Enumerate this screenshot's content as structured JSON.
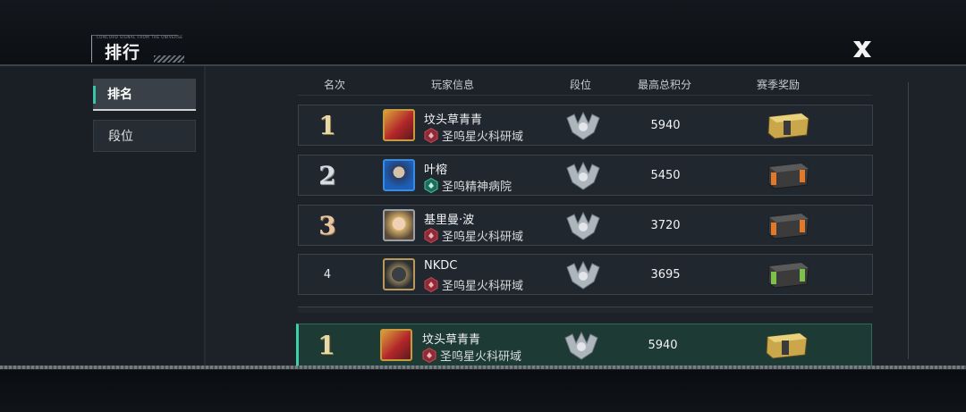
{
  "header": {
    "title": "排行",
    "tag": "CONCORD SIGNAL FROM THE UNIVERSE"
  },
  "sidebar": {
    "items": [
      {
        "label": "排名",
        "active": true
      },
      {
        "label": "段位",
        "active": false
      }
    ]
  },
  "columns": {
    "rank": "名次",
    "player": "玩家信息",
    "tier": "段位",
    "score": "最高总积分",
    "reward": "赛季奖励"
  },
  "rows": [
    {
      "rank": "1",
      "name": "坟头草青青",
      "guild": "圣呜星火科研域",
      "score": "5940",
      "guild_icon": "red-hex-emblem-icon",
      "reward_icon": "gold-crate-icon"
    },
    {
      "rank": "2",
      "name": "叶榕",
      "guild": "圣呜精神病院",
      "score": "5450",
      "guild_icon": "teal-hex-emblem-icon",
      "reward_icon": "orange-crate-icon"
    },
    {
      "rank": "3",
      "name": "基里曼·波",
      "guild": "圣呜星火科研域",
      "score": "3720",
      "guild_icon": "red-hex-emblem-icon",
      "reward_icon": "orange-crate-icon"
    },
    {
      "rank": "4",
      "name": "NKDC",
      "guild": "圣呜星火科研域",
      "score": "3695",
      "guild_icon": "red-hex-emblem-icon",
      "reward_icon": "green-crate-icon"
    }
  ],
  "self": {
    "rank": "1",
    "name": "坟头草青青",
    "guild": "圣呜星火科研域",
    "score": "5940"
  },
  "colors": {
    "accent": "#35c7a5",
    "self_row_bg": "#1e3a34",
    "gold": "#e9d9a8",
    "silver": "#d9dde2",
    "bronze": "#e6c6a3"
  }
}
